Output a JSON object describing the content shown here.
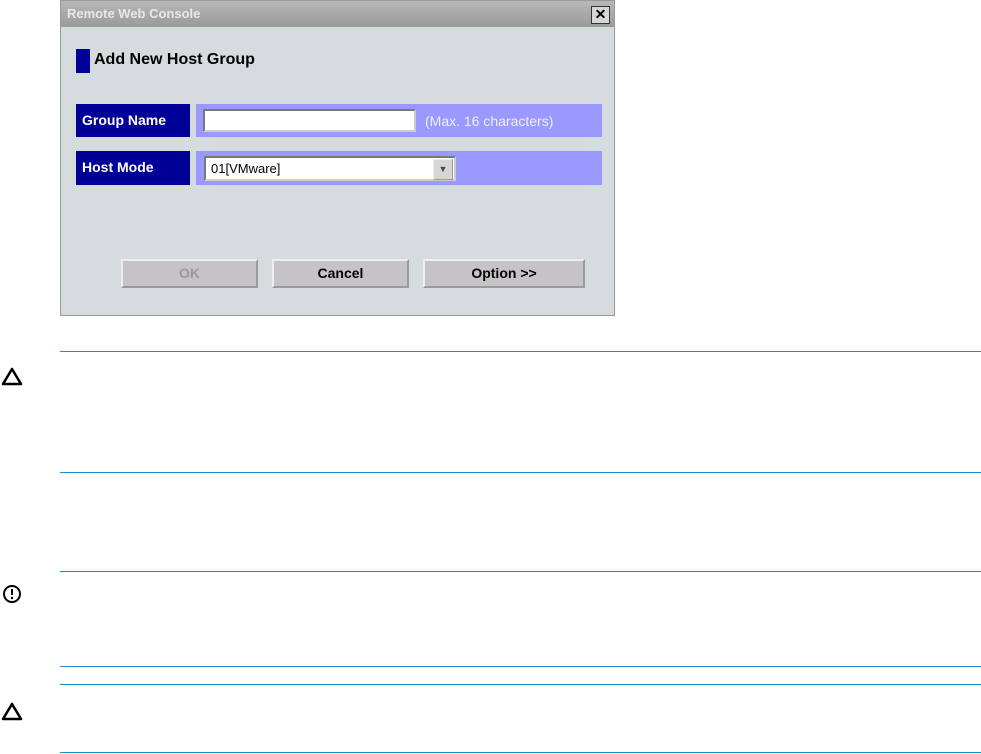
{
  "dialog": {
    "title": "Remote Web Console",
    "close_label": "✕",
    "heading": "Add New Host Group",
    "group_name": {
      "label": "Group Name",
      "value": "",
      "hint": "(Max. 16 characters)"
    },
    "host_mode": {
      "label": "Host Mode",
      "selected": "01[VMware]"
    },
    "buttons": {
      "ok": "OK",
      "cancel": "Cancel",
      "option": "Option >>"
    }
  },
  "notes": [
    {
      "icon": "caution-icon"
    },
    {
      "icon": "important-icon"
    },
    {
      "icon": "caution-icon"
    }
  ],
  "colors": {
    "accent": "#000099",
    "field_bg": "#9999ff",
    "rule": "#1a8fc9"
  }
}
